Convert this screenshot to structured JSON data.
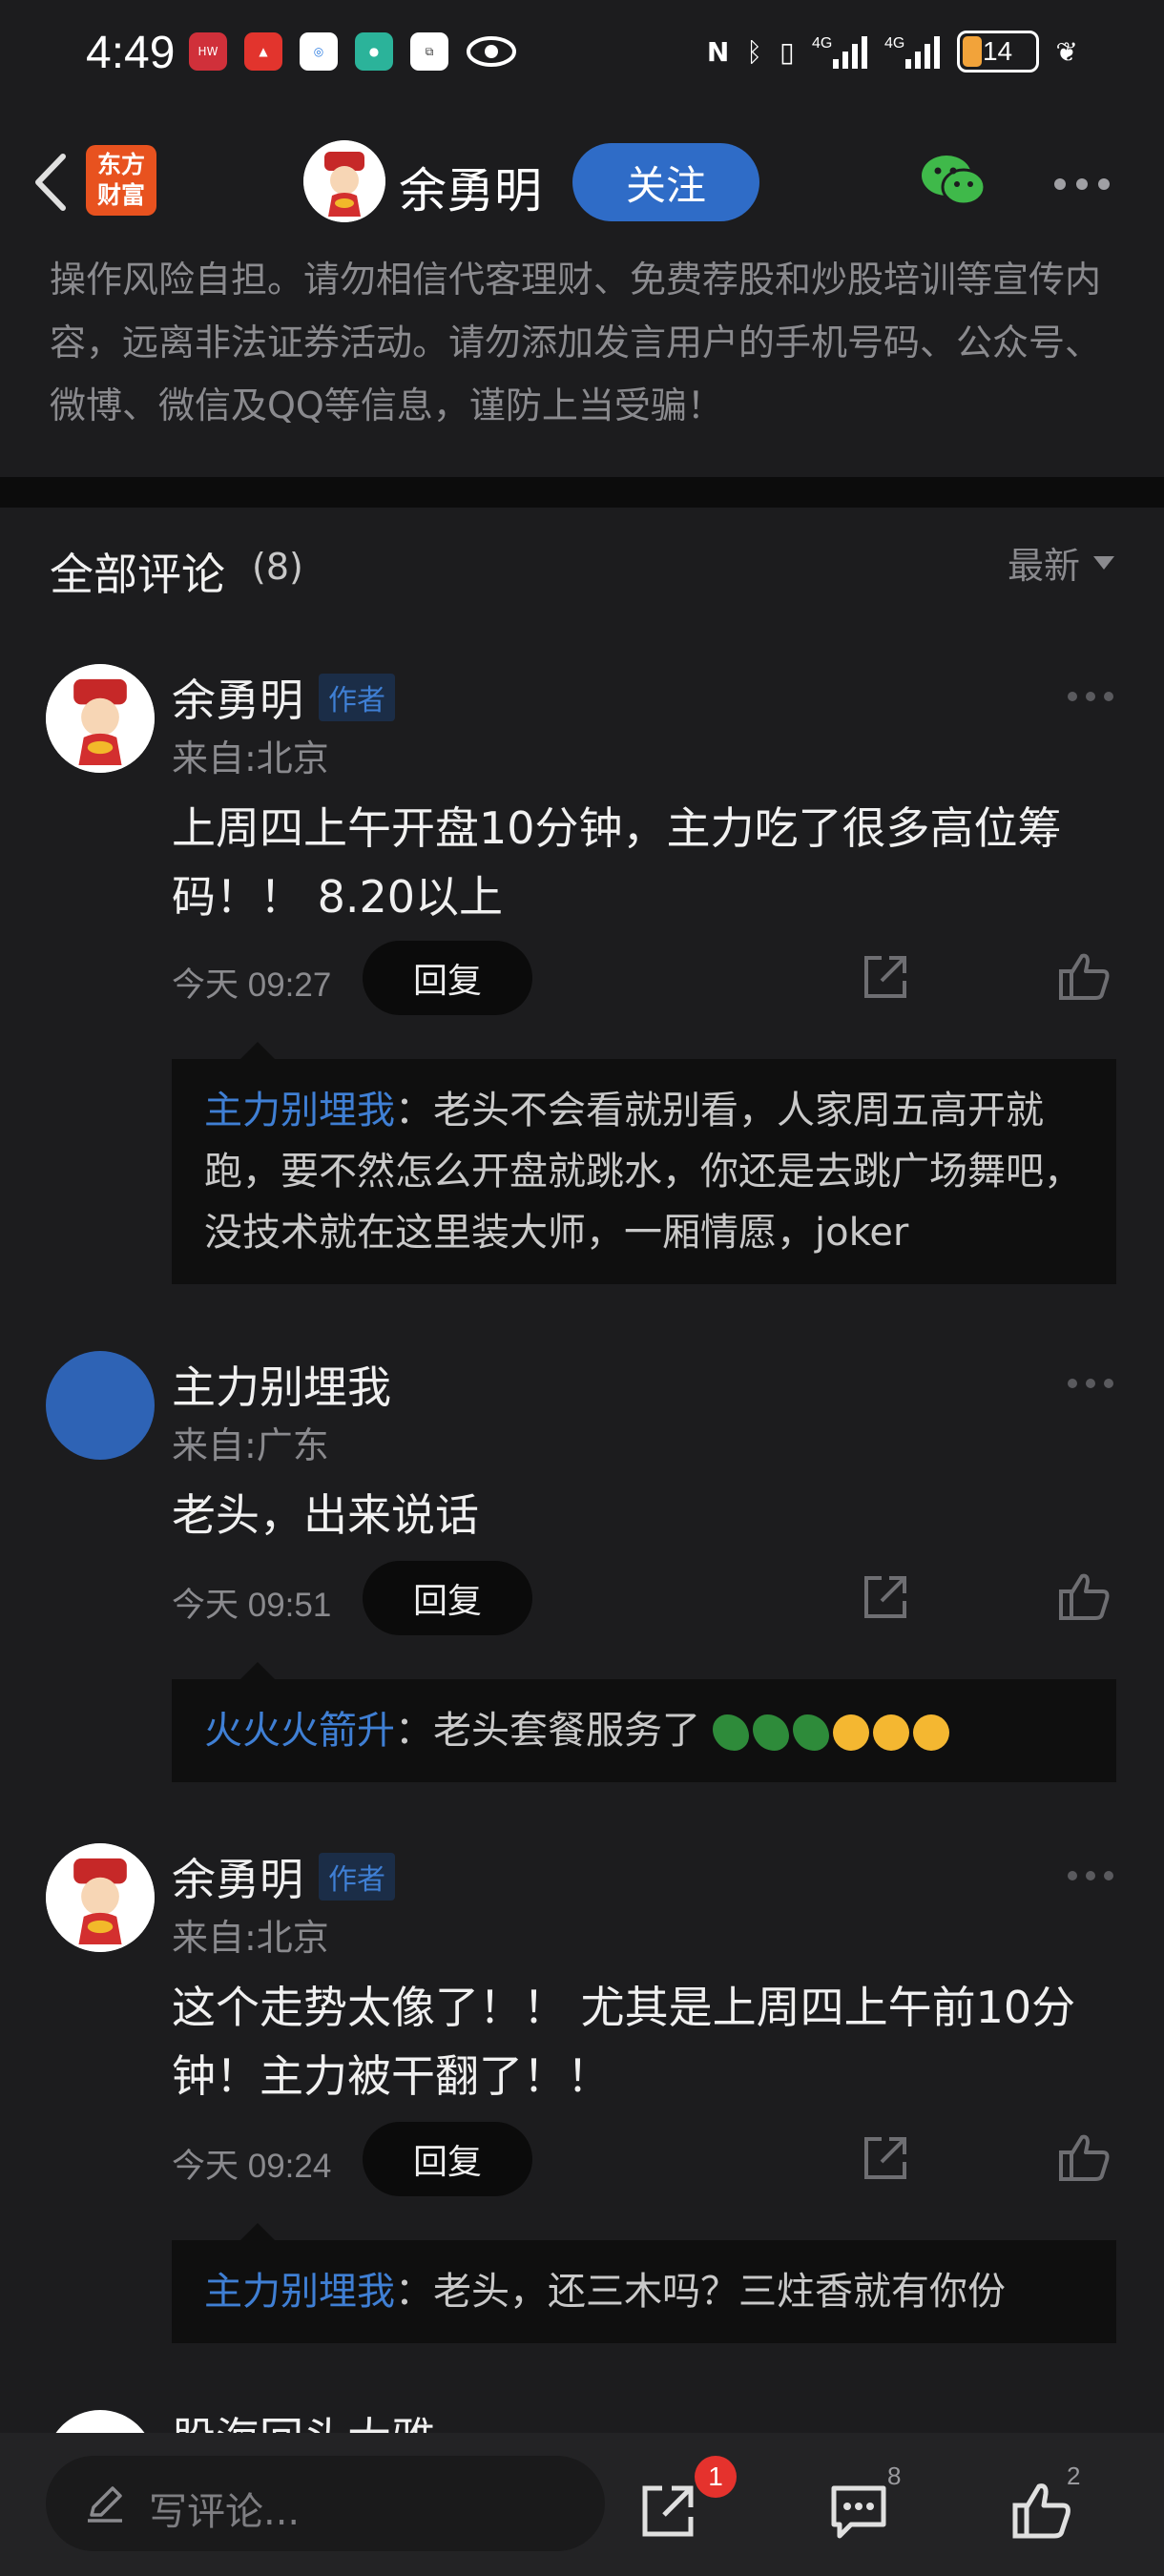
{
  "status_bar": {
    "time": "4:49",
    "battery": "14",
    "apps": [
      "huawei-app",
      "red-app",
      "browser-app",
      "teal-app",
      "share-app",
      "eye-icon"
    ],
    "indicators": [
      "NFC",
      "bluetooth",
      "vibrate",
      "4G",
      "4G"
    ]
  },
  "nav": {
    "brand": "东方财富",
    "title": "余勇明",
    "follow_label": "关注"
  },
  "disclaimer": "操作风险自担。请勿相信代客理财、免费荐股和炒股培训等宣传内容，远离非法证券活动。请勿添加发言用户的手机号码、公众号、微博、微信及QQ等信息，谨防上当受骗！",
  "comments_header": {
    "title": "全部评论",
    "count": "(8)",
    "sort_label": "最新"
  },
  "comments": [
    {
      "user": "余勇明",
      "badge": "作者",
      "location": "来自:北京",
      "text": "上周四上午开盘10分钟，主力吃了很多高位筹码！！ 8.20以上",
      "time": "今天 09:27",
      "reply_label": "回复",
      "reply": {
        "user": "主力别埋我",
        "text": "：老头不会看就别看，人家周五高开就跑，要不然怎么开盘就跳水，你还是去跳广场舞吧，没技术就在这里装大师，一厢情愿，joker"
      }
    },
    {
      "user": "主力别埋我",
      "badge": "",
      "location": "来自:广东",
      "text": "老头，出来说话",
      "time": "今天 09:51",
      "reply_label": "回复",
      "reply": {
        "user": "火火火箭升",
        "text": "：老头套餐服务了"
      }
    },
    {
      "user": "余勇明",
      "badge": "作者",
      "location": "来自:北京",
      "text": "这个走势太像了！！ 尤其是上周四上午前10分钟！主力被干翻了！！",
      "time": "今天 09:24",
      "reply_label": "回复",
      "reply": {
        "user": "主力别埋我",
        "text": "：老头，还三木吗？三炷香就有你份"
      }
    },
    {
      "user": "股海回头大雅",
      "partial": true
    }
  ],
  "bottom_bar": {
    "write_placeholder": "写评论...",
    "share_badge": "1",
    "comment_count": "8",
    "like_count": "2"
  },
  "colors": {
    "background": "#1c1c1e",
    "accent_blue": "#2f6cc7",
    "link_blue": "#3f7fd4",
    "brand_orange": "#e8521f",
    "badge_red": "#e5322d"
  }
}
